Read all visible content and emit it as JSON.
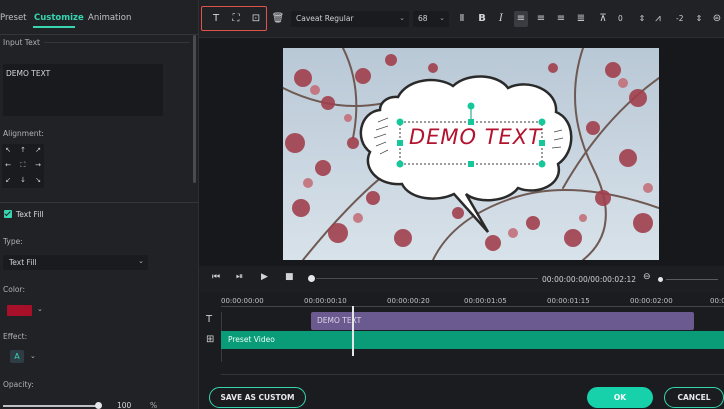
{
  "left_panel": {
    "tabs": [
      "Preset",
      "Customize",
      "Animation"
    ],
    "input_text_label": "Input Text",
    "input_text_value": "DEMO TEXT",
    "alignment_label": "Alignment:",
    "alignment_glyphs": [
      "↖",
      "↑",
      "↗",
      "←",
      "⛶",
      "→",
      "↙",
      "↓",
      "↘"
    ],
    "text_fill_label": "Text Fill",
    "type_label": "Type:",
    "type_value": "Text Fill",
    "color_label": "Color:",
    "color_value": "#a8102a",
    "effect_label": "Effect:",
    "opacity_label": "Opacity:",
    "opacity_value": "100",
    "opacity_unit": "%"
  },
  "toolbar": {
    "font_name": "Caveat Regular",
    "font_size": "68",
    "letter_spacing": "0",
    "line_spacing": "-2"
  },
  "preview": {
    "demo_text": "DEMO TEXT"
  },
  "playback": {
    "timecode": "00:00:00:00/00:00:02:12"
  },
  "timeline": {
    "ruler": [
      "00:00:00:00",
      "00:00:00:10",
      "00:00:00:20",
      "00:00:01:05",
      "00:00:01:15",
      "00:00:02:00",
      "00:0"
    ],
    "text_clip_label": "DEMO TEXT",
    "video_clip_label": "Preset Video"
  },
  "buttons": {
    "save_as_custom": "SAVE AS CUSTOM",
    "ok": "OK",
    "cancel": "CANCEL"
  },
  "colors": {
    "accent": "#38d6b0",
    "ok_button": "#16d1aa",
    "text_clip": "#6b5a8f",
    "video_clip": "#0a9b78",
    "demo_text": "#b2132e",
    "highlight_box": "#e0524a"
  }
}
